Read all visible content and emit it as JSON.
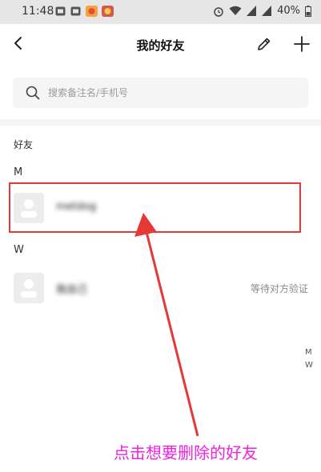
{
  "status_bar": {
    "time": "11:48",
    "battery": "40%"
  },
  "header": {
    "title": "我的好友",
    "back_icon": "chevron-left-icon",
    "edit_icon": "pencil-icon",
    "add_icon": "plus-icon"
  },
  "search": {
    "placeholder": "搜索备注名/手机号",
    "icon": "search-icon"
  },
  "section_title": "好友",
  "groups": [
    {
      "letter": "M",
      "friends": [
        {
          "name": "metdog",
          "status": ""
        }
      ]
    },
    {
      "letter": "W",
      "friends": [
        {
          "name": "我自己",
          "status": "等待对方验证"
        }
      ]
    }
  ],
  "index_letters": [
    "M",
    "W"
  ],
  "annotation": {
    "text": "点击想要删除的好友",
    "color": "#ee22dd",
    "box_color": "#e53935",
    "arrow_color": "#e53935"
  }
}
